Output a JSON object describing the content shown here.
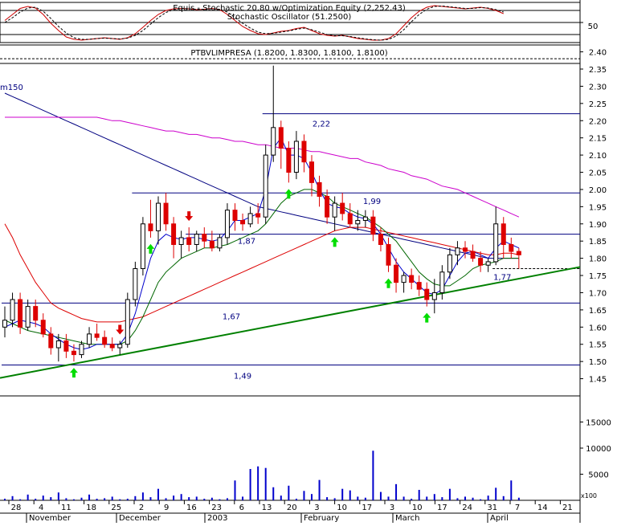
{
  "stoch_panel": {
    "title": "Equis - Stochastic 20.80  w/Optimization Equity (2,252.43)",
    "subtitle": "Stochastic Oscillator (51.2500)",
    "axis_label": "50"
  },
  "price_panel": {
    "title": "PTBVLIMPRESA (1.8200, 1.8300, 1.8100, 1.8100)",
    "ma_label": "m150"
  },
  "volume_panel": {
    "scale_label": "x100"
  },
  "chart_data": [
    {
      "type": "line",
      "panel": "stochastic",
      "title": "Equis - Stochastic 20.80  w/Optimization Equity (2,252.43)",
      "subtitle": "Stochastic Oscillator (51.2500)",
      "ylim": [
        0,
        100
      ],
      "yticks": [
        50
      ],
      "reference_lines": [
        20,
        50,
        80
      ],
      "series": [
        {
          "color": "#cc0000",
          "style": "solid",
          "values": [
            55,
            70,
            85,
            90,
            86,
            70,
            48,
            30,
            14,
            8,
            6,
            8,
            10,
            12,
            10,
            8,
            12,
            22,
            38,
            55,
            70,
            80,
            84,
            85,
            84,
            82,
            83,
            85,
            82,
            70,
            55,
            40,
            30,
            22,
            20,
            24,
            28,
            30,
            35,
            38,
            30,
            22,
            18,
            16,
            18,
            14,
            10,
            8,
            6,
            6,
            10,
            22,
            42,
            62,
            78,
            88,
            92,
            90,
            88,
            86,
            84,
            86,
            88,
            85,
            80,
            72
          ]
        },
        {
          "color": "#000000",
          "style": "dashed",
          "values": [
            50,
            62,
            76,
            86,
            88,
            78,
            60,
            40,
            24,
            12,
            8,
            8,
            10,
            11,
            10,
            9,
            11,
            18,
            30,
            46,
            62,
            75,
            82,
            85,
            84,
            83,
            83,
            84,
            83,
            76,
            62,
            48,
            36,
            26,
            22,
            23,
            26,
            29,
            33,
            36,
            32,
            26,
            20,
            17,
            17,
            15,
            12,
            9,
            7,
            6,
            8,
            16,
            32,
            52,
            70,
            83,
            90,
            91,
            89,
            87,
            85,
            85,
            87,
            86,
            82,
            76
          ]
        }
      ]
    },
    {
      "type": "candlestick",
      "panel": "price",
      "title": "PTBVLIMPRESA (1.8200, 1.8300, 1.8100, 1.8100)",
      "ylim": [
        1.4,
        2.42
      ],
      "yticks": [
        1.45,
        1.5,
        1.55,
        1.6,
        1.65,
        1.7,
        1.75,
        1.8,
        1.85,
        1.9,
        1.95,
        2.0,
        2.05,
        2.1,
        2.15,
        2.2,
        2.25,
        2.3,
        2.35,
        2.4
      ],
      "x_tick_labels": [
        "28",
        "4",
        "11",
        "18",
        "25",
        "2",
        "9",
        "16",
        "23",
        "6",
        "13",
        "20",
        "3",
        "10",
        "17",
        "3",
        "10",
        "17",
        "24",
        "31",
        "7",
        "14",
        "21"
      ],
      "month_labels": [
        "November",
        "December",
        "2003",
        "February",
        "March",
        "April"
      ],
      "ohlc": [
        [
          1.6,
          1.66,
          1.57,
          1.62
        ],
        [
          1.62,
          1.7,
          1.6,
          1.68
        ],
        [
          1.68,
          1.7,
          1.58,
          1.6
        ],
        [
          1.6,
          1.68,
          1.59,
          1.66
        ],
        [
          1.66,
          1.68,
          1.6,
          1.62
        ],
        [
          1.62,
          1.64,
          1.57,
          1.58
        ],
        [
          1.58,
          1.6,
          1.52,
          1.54
        ],
        [
          1.54,
          1.58,
          1.5,
          1.56
        ],
        [
          1.56,
          1.58,
          1.51,
          1.53
        ],
        [
          1.53,
          1.55,
          1.5,
          1.52
        ],
        [
          1.52,
          1.56,
          1.51,
          1.55
        ],
        [
          1.55,
          1.6,
          1.54,
          1.58
        ],
        [
          1.58,
          1.61,
          1.56,
          1.57
        ],
        [
          1.57,
          1.59,
          1.54,
          1.55
        ],
        [
          1.55,
          1.57,
          1.53,
          1.54
        ],
        [
          1.54,
          1.56,
          1.52,
          1.55
        ],
        [
          1.55,
          1.7,
          1.54,
          1.68
        ],
        [
          1.68,
          1.79,
          1.66,
          1.77
        ],
        [
          1.77,
          1.92,
          1.75,
          1.9
        ],
        [
          1.9,
          1.97,
          1.86,
          1.88
        ],
        [
          1.88,
          1.98,
          1.84,
          1.96
        ],
        [
          1.96,
          1.99,
          1.88,
          1.9
        ],
        [
          1.9,
          1.92,
          1.8,
          1.84
        ],
        [
          1.84,
          1.88,
          1.8,
          1.86
        ],
        [
          1.86,
          1.89,
          1.82,
          1.84
        ],
        [
          1.84,
          1.88,
          1.82,
          1.87
        ],
        [
          1.87,
          1.89,
          1.83,
          1.85
        ],
        [
          1.85,
          1.88,
          1.82,
          1.83
        ],
        [
          1.83,
          1.87,
          1.82,
          1.86
        ],
        [
          1.86,
          1.96,
          1.84,
          1.94
        ],
        [
          1.94,
          1.96,
          1.88,
          1.91
        ],
        [
          1.91,
          1.93,
          1.88,
          1.9
        ],
        [
          1.9,
          1.95,
          1.89,
          1.93
        ],
        [
          1.93,
          1.96,
          1.9,
          1.92
        ],
        [
          1.92,
          2.13,
          1.9,
          2.1
        ],
        [
          2.1,
          2.36,
          2.08,
          2.18
        ],
        [
          2.18,
          2.2,
          2.06,
          2.12
        ],
        [
          2.12,
          2.14,
          2.02,
          2.05
        ],
        [
          2.05,
          2.17,
          2.03,
          2.14
        ],
        [
          2.14,
          2.16,
          2.05,
          2.08
        ],
        [
          2.08,
          2.1,
          1.98,
          2.02
        ],
        [
          2.02,
          2.04,
          1.95,
          1.98
        ],
        [
          1.98,
          2.0,
          1.9,
          1.92
        ],
        [
          1.92,
          1.98,
          1.88,
          1.96
        ],
        [
          1.96,
          1.99,
          1.91,
          1.93
        ],
        [
          1.93,
          1.96,
          1.89,
          1.9
        ],
        [
          1.9,
          1.94,
          1.88,
          1.91
        ],
        [
          1.91,
          1.94,
          1.89,
          1.92
        ],
        [
          1.92,
          1.94,
          1.85,
          1.87
        ],
        [
          1.87,
          1.89,
          1.82,
          1.84
        ],
        [
          1.84,
          1.86,
          1.76,
          1.78
        ],
        [
          1.78,
          1.8,
          1.7,
          1.73
        ],
        [
          1.73,
          1.76,
          1.7,
          1.75
        ],
        [
          1.75,
          1.77,
          1.71,
          1.73
        ],
        [
          1.73,
          1.75,
          1.69,
          1.71
        ],
        [
          1.71,
          1.73,
          1.66,
          1.68
        ],
        [
          1.68,
          1.74,
          1.64,
          1.7
        ],
        [
          1.7,
          1.78,
          1.68,
          1.76
        ],
        [
          1.76,
          1.83,
          1.74,
          1.81
        ],
        [
          1.81,
          1.85,
          1.78,
          1.83
        ],
        [
          1.83,
          1.85,
          1.8,
          1.82
        ],
        [
          1.82,
          1.84,
          1.79,
          1.8
        ],
        [
          1.8,
          1.82,
          1.76,
          1.78
        ],
        [
          1.78,
          1.8,
          1.76,
          1.79
        ],
        [
          1.79,
          1.95,
          1.78,
          1.9
        ],
        [
          1.9,
          1.92,
          1.8,
          1.84
        ],
        [
          1.84,
          1.86,
          1.8,
          1.82
        ],
        [
          1.82,
          1.83,
          1.77,
          1.81
        ]
      ],
      "overlay_lines": [
        {
          "name": "m150",
          "color": "#000080",
          "values": [
            2.28,
            2.27,
            2.26,
            2.25,
            2.24,
            2.23,
            2.22,
            2.21,
            2.2,
            2.19,
            2.18,
            2.17,
            2.16,
            2.15,
            2.14,
            2.13,
            2.12,
            2.11,
            2.1,
            2.09,
            2.08,
            2.07,
            2.06,
            2.05,
            2.04,
            2.03,
            2.02,
            2.01,
            2.0,
            1.99,
            1.98,
            1.97,
            1.96,
            1.95,
            1.945,
            1.94,
            1.935,
            1.93,
            1.925,
            1.92,
            1.915,
            1.91,
            1.905,
            1.9,
            1.895,
            1.89,
            1.885,
            1.88,
            1.875,
            1.87,
            1.865,
            1.86,
            1.855,
            1.85,
            1.845,
            1.84,
            1.835,
            1.83,
            1.825,
            1.82,
            1.815,
            1.81,
            1.805,
            1.8,
            1.8,
            1.8,
            1.8,
            1.8
          ]
        },
        {
          "color": "#cc00cc",
          "values": [
            2.21,
            2.21,
            2.21,
            2.21,
            2.21,
            2.21,
            2.21,
            2.21,
            2.21,
            2.21,
            2.21,
            2.21,
            2.21,
            2.205,
            2.2,
            2.2,
            2.195,
            2.19,
            2.185,
            2.18,
            2.175,
            2.17,
            2.17,
            2.165,
            2.16,
            2.16,
            2.155,
            2.15,
            2.15,
            2.145,
            2.14,
            2.14,
            2.135,
            2.13,
            2.13,
            2.125,
            2.12,
            2.12,
            2.12,
            2.115,
            2.11,
            2.11,
            2.105,
            2.1,
            2.095,
            2.09,
            2.09,
            2.08,
            2.075,
            2.07,
            2.06,
            2.055,
            2.05,
            2.04,
            2.035,
            2.03,
            2.02,
            2.01,
            2.005,
            2.0,
            1.99,
            1.98,
            1.97,
            1.96,
            1.95,
            1.94,
            1.93,
            1.92
          ]
        },
        {
          "color": "#dd0000",
          "values": [
            1.9,
            1.86,
            1.81,
            1.77,
            1.73,
            1.7,
            1.67,
            1.655,
            1.645,
            1.635,
            1.625,
            1.62,
            1.615,
            1.615,
            1.615,
            1.615,
            1.62,
            1.625,
            1.63,
            1.64,
            1.65,
            1.66,
            1.67,
            1.68,
            1.69,
            1.7,
            1.71,
            1.72,
            1.73,
            1.74,
            1.75,
            1.76,
            1.77,
            1.78,
            1.79,
            1.8,
            1.81,
            1.82,
            1.83,
            1.84,
            1.85,
            1.86,
            1.87,
            1.88,
            1.885,
            1.89,
            1.89,
            1.89,
            1.885,
            1.88,
            1.875,
            1.87,
            1.865,
            1.86,
            1.855,
            1.85,
            1.845,
            1.84,
            1.835,
            1.83,
            1.825,
            1.82,
            1.815,
            1.81,
            1.81,
            1.815,
            1.815,
            1.81
          ]
        },
        {
          "color": "#006600",
          "values": [
            1.62,
            1.61,
            1.6,
            1.59,
            1.585,
            1.58,
            1.575,
            1.57,
            1.565,
            1.56,
            1.555,
            1.55,
            1.55,
            1.55,
            1.55,
            1.55,
            1.56,
            1.59,
            1.63,
            1.68,
            1.73,
            1.76,
            1.78,
            1.8,
            1.81,
            1.82,
            1.83,
            1.83,
            1.835,
            1.84,
            1.85,
            1.86,
            1.87,
            1.88,
            1.9,
            1.93,
            1.96,
            1.98,
            1.99,
            2.0,
            2.0,
            1.99,
            1.98,
            1.96,
            1.95,
            1.94,
            1.93,
            1.92,
            1.905,
            1.89,
            1.87,
            1.85,
            1.82,
            1.79,
            1.76,
            1.74,
            1.725,
            1.72,
            1.72,
            1.735,
            1.75,
            1.77,
            1.78,
            1.785,
            1.79,
            1.8,
            1.8,
            1.8
          ]
        },
        {
          "color": "#0000cc",
          "values": [
            1.6,
            1.61,
            1.62,
            1.615,
            1.61,
            1.6,
            1.58,
            1.565,
            1.55,
            1.54,
            1.535,
            1.54,
            1.55,
            1.55,
            1.55,
            1.55,
            1.58,
            1.64,
            1.72,
            1.8,
            1.85,
            1.87,
            1.86,
            1.855,
            1.86,
            1.86,
            1.855,
            1.85,
            1.855,
            1.88,
            1.91,
            1.91,
            1.92,
            1.93,
            2.0,
            2.12,
            2.15,
            2.1,
            2.1,
            2.09,
            2.05,
            2.0,
            1.96,
            1.95,
            1.945,
            1.93,
            1.92,
            1.915,
            1.9,
            1.87,
            1.83,
            1.79,
            1.76,
            1.74,
            1.72,
            1.7,
            1.695,
            1.71,
            1.75,
            1.79,
            1.815,
            1.82,
            1.81,
            1.8,
            1.83,
            1.85,
            1.84,
            1.83
          ]
        }
      ],
      "trendline": {
        "color": "#008000",
        "from": [
          0,
          1.455
        ],
        "to": [
          68,
          1.745
        ]
      },
      "horizontal_levels": [
        {
          "label": "2,22",
          "value": 2.22,
          "from": 34
        },
        {
          "label": "1,99",
          "value": 1.99,
          "from": 17
        },
        {
          "label": "1,87",
          "value": 1.87,
          "from": 24
        },
        {
          "label": "1,67",
          "value": 1.67,
          "from": 0
        },
        {
          "label": "1,49",
          "value": 1.49,
          "from": 0
        },
        {
          "label": "1,77",
          "value": 1.77,
          "from": 64,
          "style": "dashed"
        }
      ],
      "buy_signals": [
        9,
        19,
        37,
        43,
        50,
        55
      ],
      "sell_signals": [
        15,
        24
      ]
    },
    {
      "type": "bar",
      "panel": "volume",
      "ylim": [
        0,
        20000
      ],
      "yticks": [
        5000,
        10000,
        15000
      ],
      "values": [
        300,
        800,
        200,
        1100,
        300,
        900,
        600,
        1500,
        400,
        200,
        500,
        1100,
        300,
        400,
        700,
        200,
        300,
        800,
        1500,
        600,
        2200,
        400,
        900,
        1200,
        600,
        700,
        300,
        500,
        200,
        400,
        3800,
        700,
        6000,
        6500,
        6200,
        2500,
        900,
        2800,
        300,
        1800,
        1200,
        3900,
        600,
        400,
        2200,
        1900,
        700,
        500,
        9500,
        1600,
        700,
        3100,
        700,
        300,
        2000,
        700,
        1200,
        600,
        2200,
        400,
        700,
        500,
        200,
        900,
        2400,
        800,
        3800,
        500
      ]
    }
  ]
}
